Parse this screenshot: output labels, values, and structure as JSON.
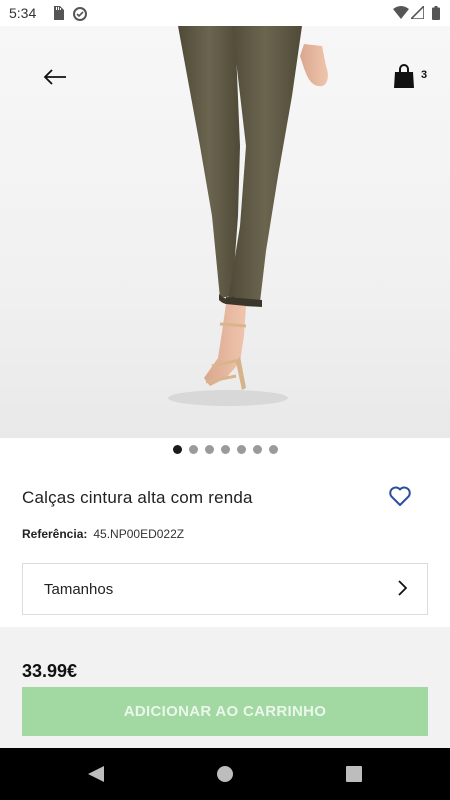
{
  "status_bar": {
    "time": "5:34"
  },
  "header": {
    "cart_count": "3"
  },
  "gallery": {
    "image_count": 7,
    "active_index": 0
  },
  "product": {
    "title": "Calças cintura alta com renda",
    "reference_label": "Referência:",
    "reference_value": "45.NP00ED022Z",
    "sizes_label": "Tamanhos",
    "price": "33.99€",
    "add_button_label": "ADICIONAR AO CARRINHO"
  },
  "colors": {
    "accent_button": "#a2d8a2",
    "favorite_icon": "#2b4ea0",
    "active_dot": "#1a1a1a",
    "inactive_dot": "#9a9a9a"
  }
}
